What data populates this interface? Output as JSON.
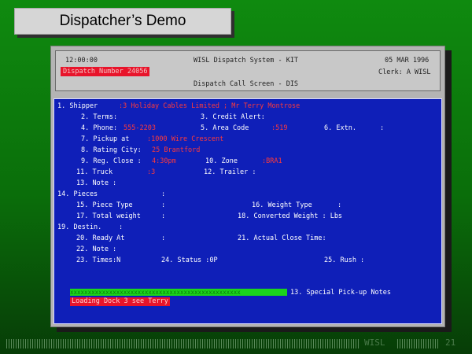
{
  "slide": {
    "title": "Dispatcher’s Demo",
    "footer_brand": "WISL",
    "page_number": "21"
  },
  "header": {
    "time": "12:00:00",
    "system_title": "WISL Dispatch System - KIT",
    "date": "05 MAR 1996",
    "dispatch_number": "Dispatch Number 24056",
    "clerk": "Clerk: A WISL",
    "screen_title": "Dispatch Call Screen - DIS"
  },
  "form": {
    "shipper_label": "1. Shipper",
    "shipper_value": ":3 Holiday Cables Limited ; Mr Terry Montrose",
    "terms_label": "2. Terms:",
    "credit_alert_label": "3. Credit Alert:",
    "phone_label": "4. Phone:",
    "phone_value": "555-2203",
    "area_code_label": "5. Area Code",
    "area_code_value": ":519",
    "extn_label": "6. Extn.",
    "extn_value": ":",
    "pickup_label": "7. Pickup at",
    "pickup_value": ":1000 Wire Crescent",
    "rating_city_label": "8. Rating City:",
    "rating_city_value": "25 Brantford",
    "reg_close_label": "9. Reg. Close :",
    "reg_close_value": "4:30pm",
    "zone_label": "10. Zone",
    "zone_value": ":BRA1",
    "truck_label": "11. Truck",
    "truck_value": ":3",
    "trailer_label": "12. Trailer :",
    "note13_label": "13. Note :",
    "pieces_label": "14. Pieces",
    "pieces_value": ":",
    "piece_type_label": "15. Piece Type",
    "piece_type_value": ":",
    "weight_type_label": "16. Weight Type",
    "weight_type_value": ":",
    "total_weight_label": "17. Total weight",
    "total_weight_value": ":",
    "converted_weight_label": "18. Converted Weight : Lbs",
    "destin_label": "19. Destin.",
    "destin_value": ":",
    "ready_at_label": "20. Ready At",
    "ready_at_value": ":",
    "actual_close_label": "21. Actual Close Time:",
    "note22_label": "22. Note :",
    "times_label": "23. Times:N",
    "status_label": "24. Status :0P",
    "rush_label": "25. Rush :",
    "special_notes_label": "13. Special Pick-up Notes",
    "special_notes_bar": "xxxxxxxxxxxxxxxxxxxxxxxxxxxxxxxxxxxxxxxxxxxxxxxx",
    "special_notes_value": "Loading Dock 3 see Terry"
  }
}
